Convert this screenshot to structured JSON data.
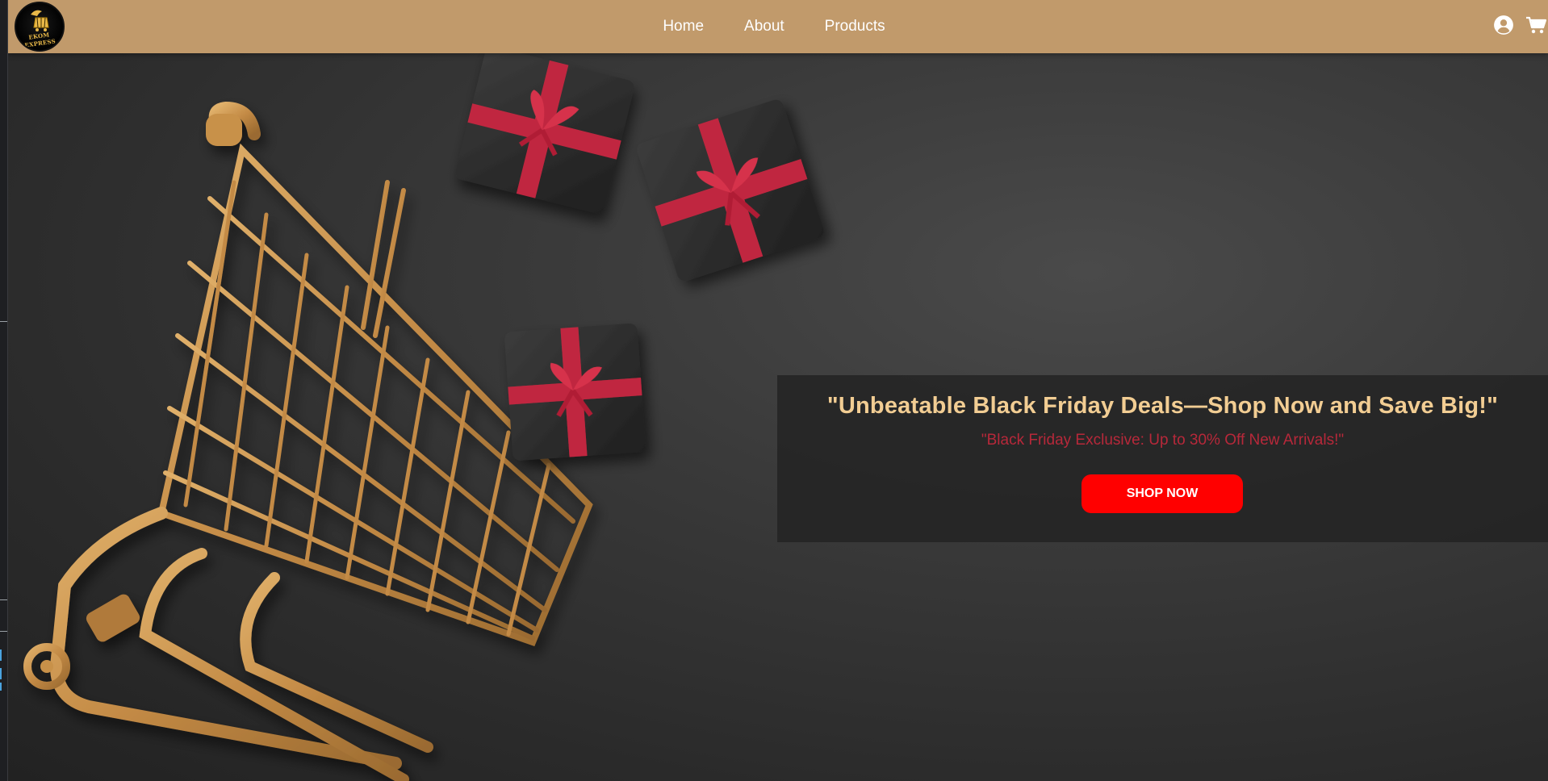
{
  "brand": {
    "logo_text": "EKOM EXPRESS"
  },
  "nav": {
    "links": [
      {
        "label": "Home"
      },
      {
        "label": "About"
      },
      {
        "label": "Products"
      }
    ],
    "icons": [
      "user-circle-icon",
      "cart-icon"
    ]
  },
  "hero": {
    "title": "\"Unbeatable Black Friday Deals—Shop Now and Save Big!\"",
    "subtitle": "\"Black Friday Exclusive: Up to 30% Off New Arrivals!\"",
    "cta_label": "SHOP NOW"
  },
  "colors": {
    "navbar_bg": "#c19a6b",
    "hero_bg": "#2f2f2f",
    "title_color": "#f2cd93",
    "subtitle_color": "#b7283a",
    "cta_bg": "#ff0000",
    "cart_gold": "#c8914a",
    "ribbon_red": "#c0283f"
  }
}
